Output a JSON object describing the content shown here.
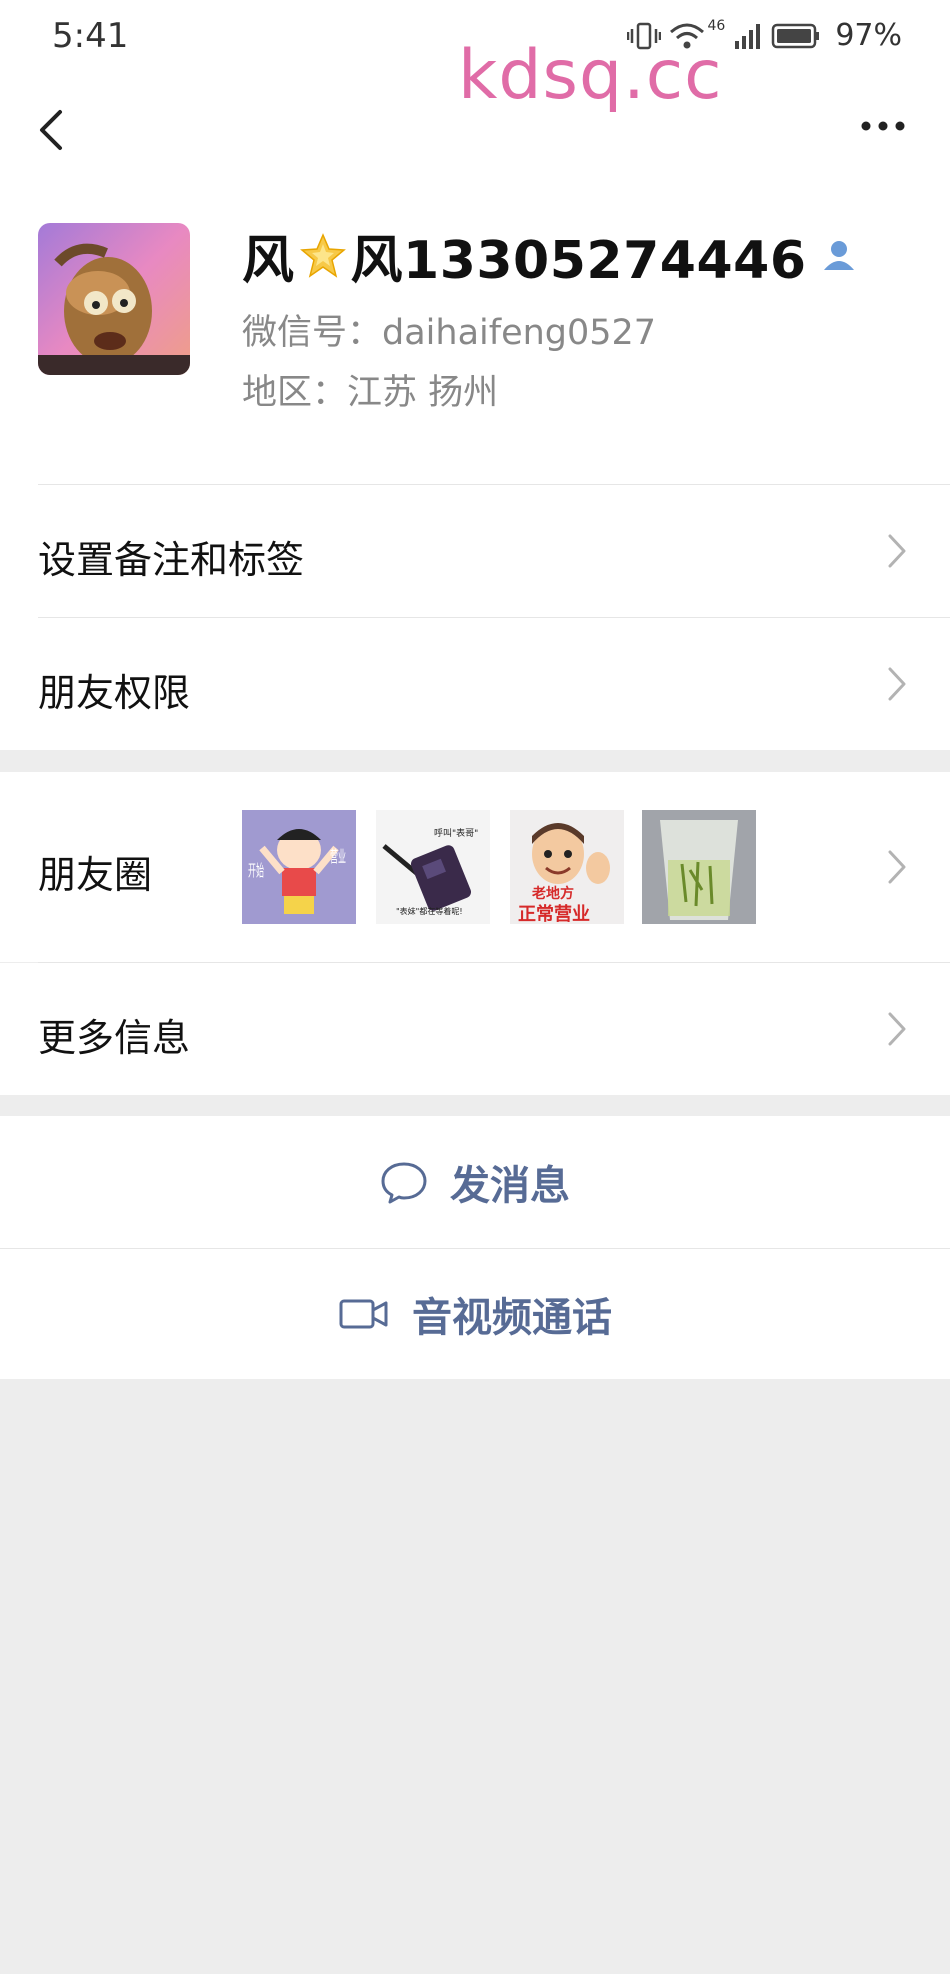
{
  "status_bar": {
    "time": "5:41",
    "network": "46",
    "battery_percent": "97%"
  },
  "watermark": "kdsq.cc",
  "nav": {
    "back_icon": "chevron-left-icon",
    "more_icon": "more-dots-icon"
  },
  "profile": {
    "name_part1": "风",
    "name_part2": "风13305274446",
    "wechat_id": "微信号：daihaifeng0527",
    "region": "地区：江苏  扬州"
  },
  "menu": {
    "remark_tags": "设置备注和标签",
    "permissions": "朋友权限",
    "moments": "朋友圈",
    "more_info": "更多信息"
  },
  "moments_thumbs": [
    {
      "caption_left": "开始",
      "caption_right": "营业"
    },
    {
      "caption_top": "呼叫\"表哥\"",
      "caption_bottom": "\"表妹\"都在等着呢!"
    },
    {
      "caption": "老地方",
      "caption2": "正常营业"
    },
    {
      "caption": ""
    }
  ],
  "actions": {
    "send_message": "发消息",
    "video_call": "音视频通话"
  },
  "colors": {
    "link_blue": "#576b95",
    "watermark_pink": "#e06ca7",
    "background_gray": "#ededed"
  }
}
